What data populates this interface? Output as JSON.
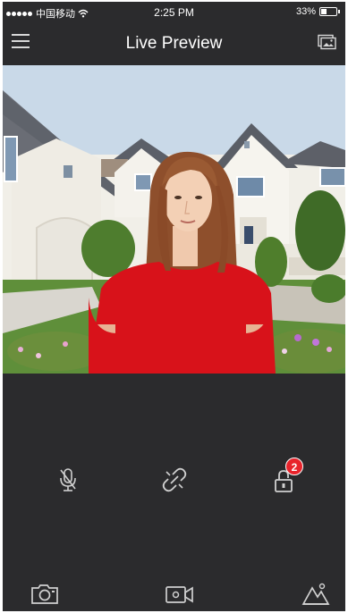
{
  "status_bar": {
    "carrier": "中国移动",
    "time": "2:25 PM",
    "battery": "33%",
    "battery_level": 0.33
  },
  "header": {
    "title": "Live Preview"
  },
  "controls": {
    "lock_badge_count": "2"
  },
  "colors": {
    "background": "#2b2b2d",
    "badge": "#e8232b",
    "icon": "#d0d0d0"
  },
  "icons": [
    "menu-icon",
    "gallery-icon",
    "microphone-icon",
    "unlink-icon",
    "lock-icon",
    "camera-icon",
    "video-record-icon",
    "scenery-icon"
  ]
}
